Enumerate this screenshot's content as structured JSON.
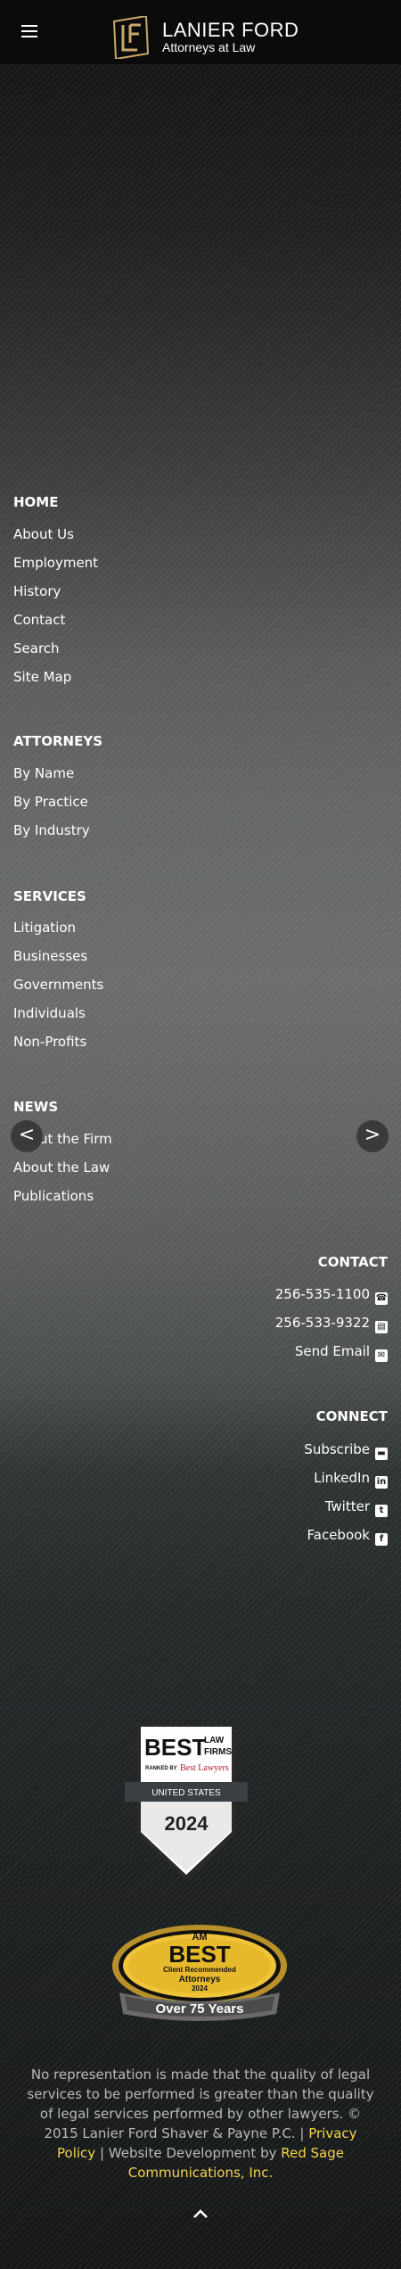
{
  "header": {
    "logo_name": "LANIER FORD",
    "logo_sub": "Attorneys at Law",
    "menu_icon": "hamburger-menu-icon"
  },
  "home": {
    "title": "HOME",
    "links": [
      "About Us",
      "Employment",
      "History",
      "Contact",
      "Search",
      "Site Map"
    ]
  },
  "attorneys": {
    "title": "ATTORNEYS",
    "links": [
      "By Name",
      "By Practice",
      "By Industry"
    ]
  },
  "services": {
    "title": "SERVICES",
    "links": [
      "Litigation",
      "Businesses",
      "Governments",
      "Individuals",
      "Non-Profits"
    ]
  },
  "news": {
    "title": "NEWS",
    "links": [
      "About the Firm",
      "About the Law",
      "Publications"
    ]
  },
  "carousel": {
    "prev_icon": "chevron-left-icon",
    "next_icon": "chevron-right-icon",
    "prev": "<",
    "next": ">"
  },
  "contact": {
    "title": "CONTACT",
    "phone": "256-535-1100",
    "fax": "256-533-9322",
    "email": "Send Email"
  },
  "connect": {
    "title": "CONNECT",
    "subscribe": "Subscribe",
    "linkedin": "LinkedIn",
    "twitter": "Twitter",
    "facebook": "Facebook"
  },
  "badges": {
    "best": {
      "line1": "BEST",
      "line2": "LAW",
      "line3": "FIRMS",
      "ranked": "RANKED BY",
      "ranker": "Best Lawyers",
      "country": "UNITED STATES",
      "year": "2024"
    },
    "am": {
      "am": "AM",
      "best": "BEST",
      "line1": "Client Recommended",
      "line2": "Attorneys",
      "year": "2024",
      "ribbon": "Over 75 Years"
    }
  },
  "footer": {
    "disclaimer": "No representation is made that the quality of legal services to be performed is greater than the quality of legal services performed by other lawyers.",
    "copyright": "© 2015 Lanier Ford Shaver & Payne P.C. |",
    "privacy": "Privacy Policy",
    "dev_prefix": "| Website Development by",
    "developer": "Red Sage Communications, Inc."
  },
  "colors": {
    "gold": "#f3d34e",
    "logo_gold": "#c9a86a"
  }
}
